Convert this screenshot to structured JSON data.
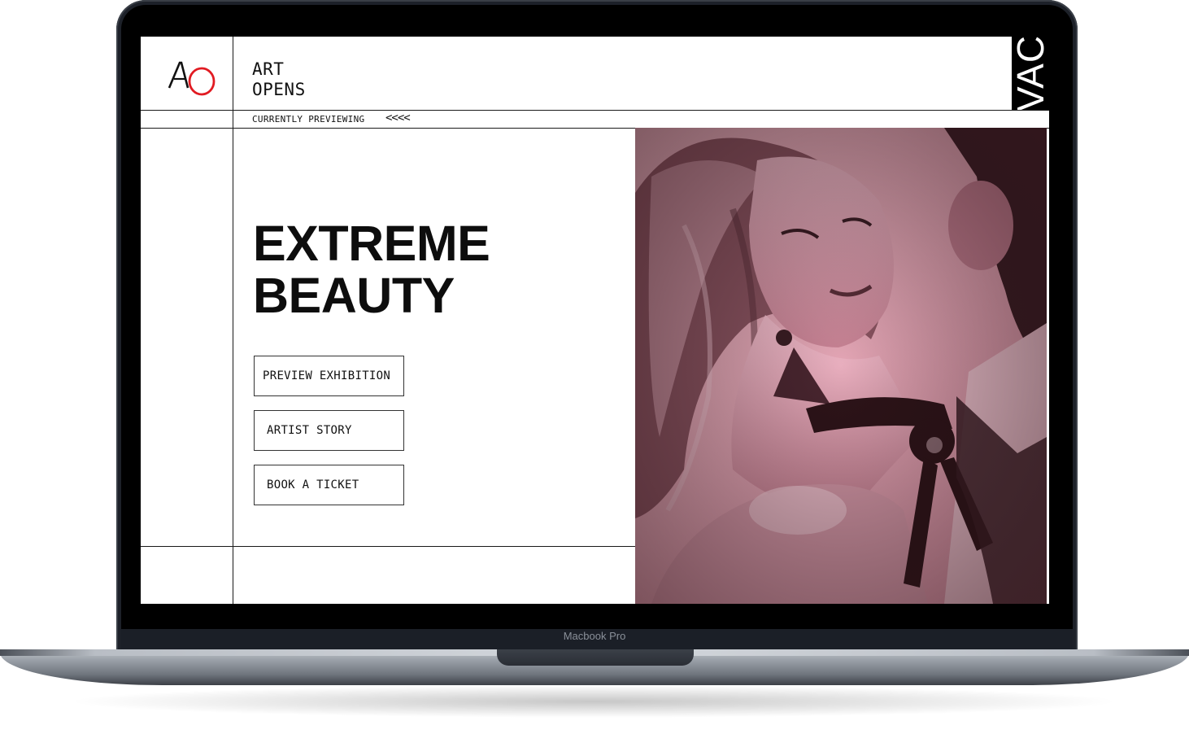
{
  "device": {
    "label": "Macbook Pro"
  },
  "site": {
    "logo_text": "AO",
    "brand_line1": "ART",
    "brand_line2": "OPENS",
    "currently_previewing": "CURRENTLY PREVIEWING",
    "arrows": "<<<<",
    "side_tab": "VAC"
  },
  "hero": {
    "headline_line1": "EXTREME",
    "headline_line2": "BEAUTY",
    "buttons": [
      {
        "label": "PREVIEW EXHIBITION"
      },
      {
        "label": "ARTIST STORY"
      },
      {
        "label": "BOOK A TICKET"
      }
    ],
    "image_tint": "#e7aab8"
  },
  "colors": {
    "accent_red": "#e11b22",
    "ink": "#111111",
    "photo_pink": "#e7aab8",
    "photo_dark": "#3a1d24"
  }
}
